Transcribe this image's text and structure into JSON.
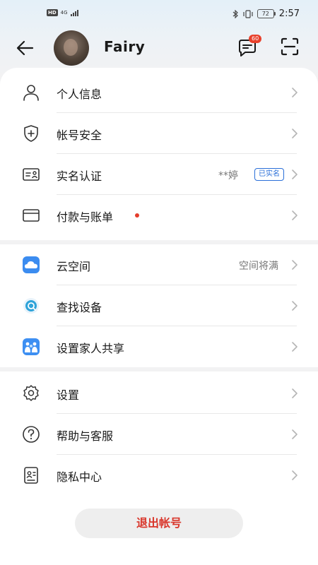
{
  "status_bar": {
    "hd": "HD",
    "network": "4G",
    "battery": "72",
    "time": "2:57"
  },
  "header": {
    "back_icon": "back-arrow-icon",
    "user_name": "Fairy",
    "message_badge": "60",
    "scan_icon": "scan-icon"
  },
  "sections": [
    {
      "items": [
        {
          "label": "个人信息",
          "icon": "person-icon"
        },
        {
          "label": "帐号安全",
          "icon": "shield-icon"
        },
        {
          "label": "实名认证",
          "icon": "id-card-icon",
          "value": "**婷",
          "badge": "已实名"
        },
        {
          "label": "付款与账单",
          "icon": "card-icon",
          "dot": true
        }
      ]
    },
    {
      "items": [
        {
          "label": "云空间",
          "icon": "cloud-icon",
          "value": "空间将满"
        },
        {
          "label": "查找设备",
          "icon": "find-device-icon"
        },
        {
          "label": "设置家人共享",
          "icon": "family-share-icon"
        }
      ]
    },
    {
      "items": [
        {
          "label": "设置",
          "icon": "gear-icon"
        },
        {
          "label": "帮助与客服",
          "icon": "help-icon"
        },
        {
          "label": "隐私中心",
          "icon": "privacy-icon"
        }
      ]
    }
  ],
  "logout_label": "退出帐号",
  "colors": {
    "accent_red": "#e43d2c",
    "verified_blue": "#2a6fd8",
    "cloud_blue": "#3b8cf0"
  }
}
